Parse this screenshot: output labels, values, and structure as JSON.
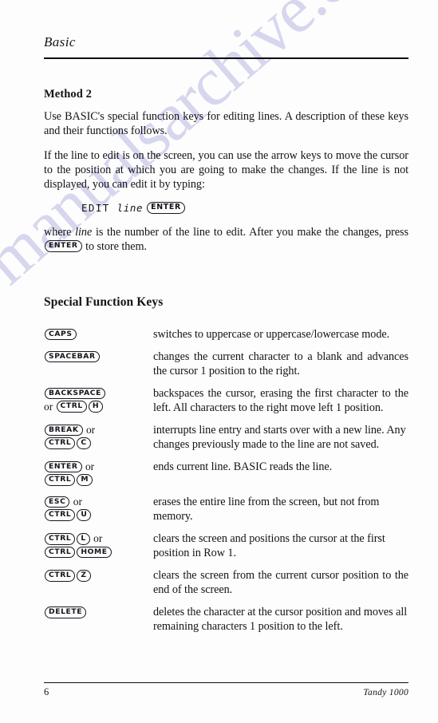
{
  "page": {
    "running_head": "Basic",
    "folio": "6",
    "imprint": "Tandy 1000",
    "watermark": "manualsarchive.com"
  },
  "sections": {
    "method_heading": "Method 2",
    "para1": "Use BASIC's special function keys for editing lines. A description of these keys and their functions follows.",
    "para2": "If the line to edit is on the screen, you can use the arrow keys to move the cursor to the position at which you are going to make the changes. If the line is not displayed, you can edit it by typing:",
    "syntax": {
      "command": "EDIT",
      "argument": "line",
      "key": "ENTER"
    },
    "para3_a": "where ",
    "para3_italic": "line",
    "para3_b": " is the number of the line to edit. After you make the changes, press ",
    "para3_key": "ENTER",
    "para3_c": " to store them.",
    "sfk_heading": "Special Function Keys"
  },
  "special_function_keys": [
    {
      "key_lines": [
        {
          "parts": [
            {
              "type": "key",
              "text": "CAPS"
            }
          ]
        }
      ],
      "description": "switches to uppercase or uppercase/lowercase mode.",
      "justify": false
    },
    {
      "key_lines": [
        {
          "parts": [
            {
              "type": "key",
              "text": "SPACEBAR"
            }
          ]
        }
      ],
      "description": "changes the current character to a blank and advances the cursor 1 position to the right.",
      "justify": true
    },
    {
      "key_lines": [
        {
          "parts": [
            {
              "type": "key",
              "text": "BACKSPACE"
            }
          ]
        },
        {
          "parts": [
            {
              "type": "word",
              "text": "or "
            },
            {
              "type": "key",
              "text": "CTRL"
            },
            {
              "type": "key",
              "text": "H"
            }
          ]
        }
      ],
      "description": "backspaces the cursor, erasing the first character to the left. All characters to the right move left 1 position.",
      "justify": true
    },
    {
      "key_lines": [
        {
          "parts": [
            {
              "type": "key",
              "text": "BREAK"
            },
            {
              "type": "word",
              "text": " or"
            }
          ]
        },
        {
          "parts": [
            {
              "type": "key",
              "text": "CTRL"
            },
            {
              "type": "key",
              "text": "C"
            }
          ]
        }
      ],
      "description": "interrupts line entry and starts over with a new line. Any changes previously made to the line are not saved.",
      "justify": false
    },
    {
      "key_lines": [
        {
          "parts": [
            {
              "type": "key",
              "text": "ENTER"
            },
            {
              "type": "word",
              "text": " or"
            }
          ]
        },
        {
          "parts": [
            {
              "type": "key",
              "text": "CTRL"
            },
            {
              "type": "key",
              "text": "M"
            }
          ]
        }
      ],
      "description": "ends current line. BASIC reads the line.",
      "justify": false
    },
    {
      "key_lines": [
        {
          "parts": [
            {
              "type": "key",
              "text": "ESC"
            },
            {
              "type": "word",
              "text": " or"
            }
          ]
        },
        {
          "parts": [
            {
              "type": "key",
              "text": "CTRL"
            },
            {
              "type": "key",
              "text": "U"
            }
          ]
        }
      ],
      "description": "erases the entire line from the screen, but not from memory.",
      "justify": false
    },
    {
      "key_lines": [
        {
          "parts": [
            {
              "type": "key",
              "text": "CTRL"
            },
            {
              "type": "key",
              "text": "L"
            },
            {
              "type": "word",
              "text": " or"
            }
          ]
        },
        {
          "parts": [
            {
              "type": "key",
              "text": "CTRL"
            },
            {
              "type": "key",
              "text": "HOME"
            }
          ]
        }
      ],
      "description": "clears the screen and positions the cursor at the first position in Row 1.",
      "justify": false
    },
    {
      "key_lines": [
        {
          "parts": [
            {
              "type": "key",
              "text": "CTRL"
            },
            {
              "type": "key",
              "text": "Z"
            }
          ]
        }
      ],
      "description": "clears the screen from the current cursor position to the end of the screen.",
      "justify": true
    },
    {
      "key_lines": [
        {
          "parts": [
            {
              "type": "key",
              "text": "DELETE"
            }
          ]
        }
      ],
      "description": "deletes the character at the cursor position and moves all remaining characters 1 position to the left.",
      "justify": false
    }
  ]
}
